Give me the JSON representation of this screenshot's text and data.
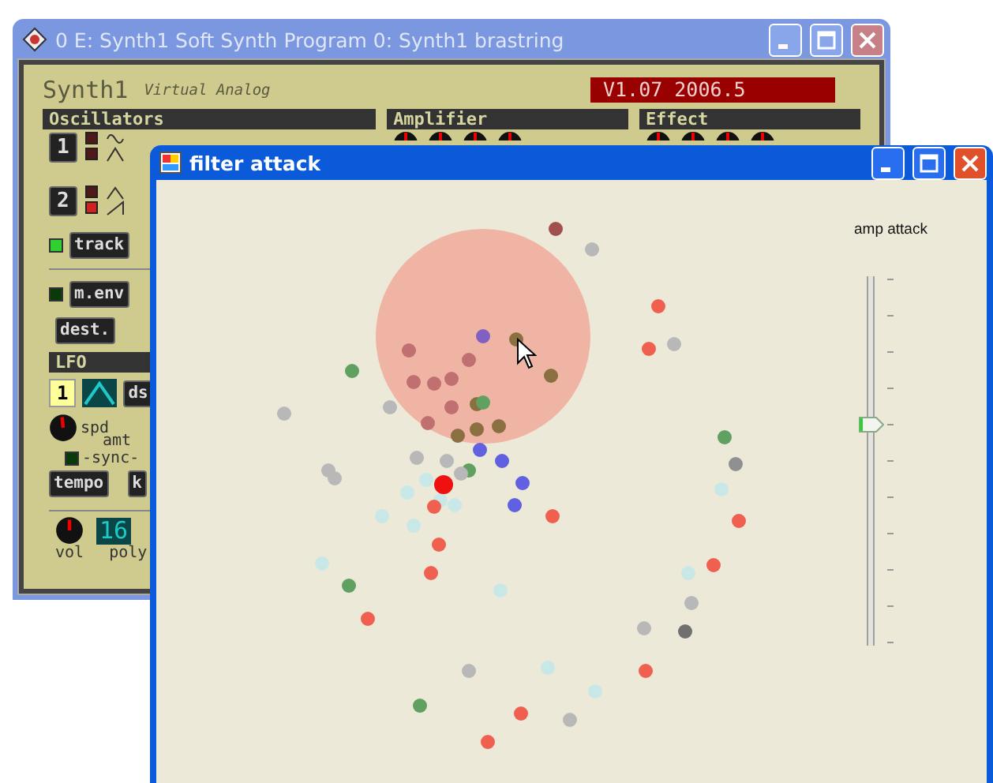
{
  "synth_window": {
    "title": "0 E: Synth1 Soft Synth Program 0: Synth1 brastring",
    "active": false
  },
  "synth_panel": {
    "name": "Synth1",
    "subtitle": "Virtual Analog",
    "version": "V1.07 2006.5",
    "sections": [
      "Oscillators",
      "Amplifier",
      "Effect"
    ],
    "oscillators": [
      {
        "label": "1"
      },
      {
        "label": "2"
      }
    ],
    "track": {
      "label": "track",
      "on": true
    },
    "menv": {
      "label": "m.env",
      "on": false
    },
    "dest": {
      "label": "dest."
    },
    "lfo": {
      "title": "LFO",
      "number": "1",
      "dst": "ds",
      "spd": "spd",
      "amt": "amt",
      "sync": "-sync-",
      "sync_on": false,
      "tempo": "tempo",
      "key": "k"
    },
    "vol": "vol",
    "poly_value": "16",
    "poly": "poly"
  },
  "filter_window": {
    "title": "filter attack",
    "active": true,
    "slider": {
      "label": "amp attack",
      "level": 0.6
    }
  }
}
